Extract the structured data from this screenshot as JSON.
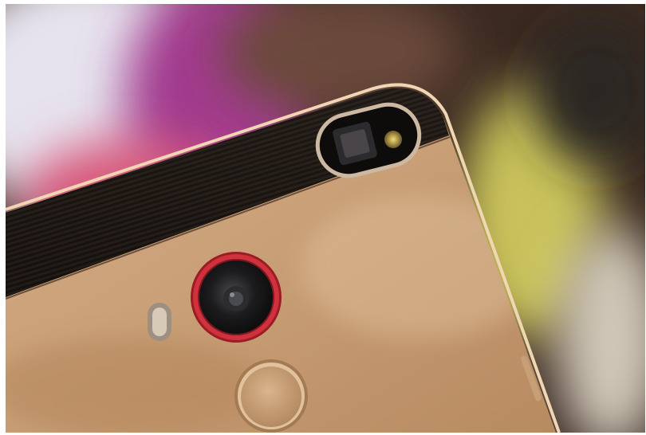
{
  "photo": {
    "subject": "gold-phone-back",
    "colors": {
      "phone_body": "#c9a27a",
      "phone_highlight": "#e8c9a2",
      "top_band": "#1d1815",
      "camera_ring": "#c0202e",
      "backdrop_purple": "#a23b8e",
      "backdrop_pink": "#d8567a",
      "backdrop_yellow": "#c9c25a",
      "backdrop_dark": "#3b2a22"
    }
  }
}
